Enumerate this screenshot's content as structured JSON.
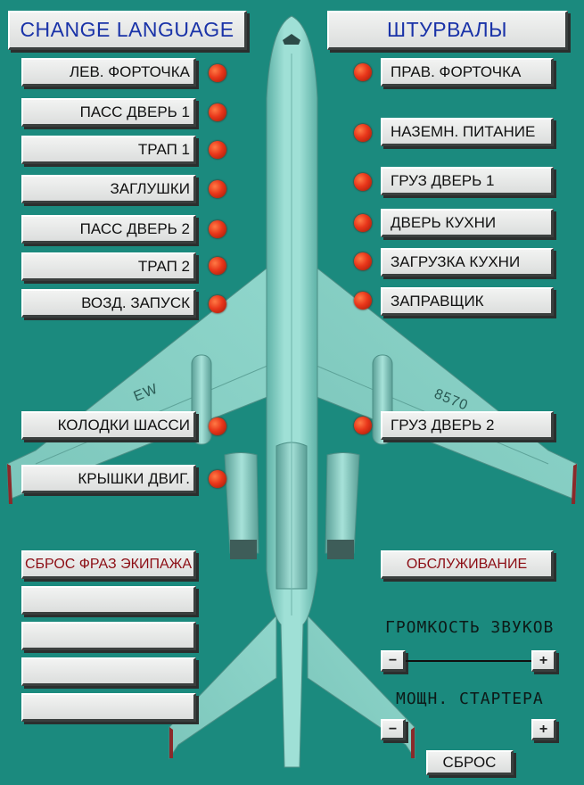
{
  "header": {
    "change_language": "CHANGE LANGUAGE",
    "yokes": "ШТУРВАЛЫ"
  },
  "left_buttons": [
    "ЛЕВ. ФОРТОЧКА",
    "ПАСС ДВЕРЬ 1",
    "ТРАП 1",
    "ЗАГЛУШКИ",
    "ПАСС ДВЕРЬ 2",
    "ТРАП 2",
    "ВОЗД. ЗАПУСК",
    "КОЛОДКИ ШАССИ",
    "КРЫШКИ ДВИГ."
  ],
  "right_buttons": [
    "ПРАВ. ФОРТОЧКА",
    "НАЗЕМН. ПИТАНИЕ",
    "ГРУЗ ДВЕРЬ 1",
    "ДВЕРЬ КУХНИ",
    "ЗАГРУЗКА КУХНИ",
    "ЗАПРАВЩИК",
    "ГРУЗ ДВЕРЬ 2"
  ],
  "crew": {
    "reset_phrases": "СБРОС ФРАЗ ЭКИПАЖА",
    "slots": [
      "",
      "",
      "",
      ""
    ]
  },
  "service": {
    "label": "ОБСЛУЖИВАНИЕ"
  },
  "sound_volume": {
    "label": "ГРОМКОСТЬ ЗВУКОВ",
    "minus": "−",
    "plus": "+",
    "level": 1.0
  },
  "starter_power": {
    "label": "МОЩН. СТАРТЕРА",
    "minus": "−",
    "plus": "+"
  },
  "reset": {
    "label": "СБРОС"
  },
  "aircraft": {
    "left_wing_mark": "EW",
    "right_wing_mark": "8570"
  },
  "colors": {
    "background": "#1b8a7e",
    "aircraft": "#88d3c8",
    "indicator_on": "#e8361a",
    "title_text": "#1a33a8",
    "alert_text": "#8c0d14"
  }
}
